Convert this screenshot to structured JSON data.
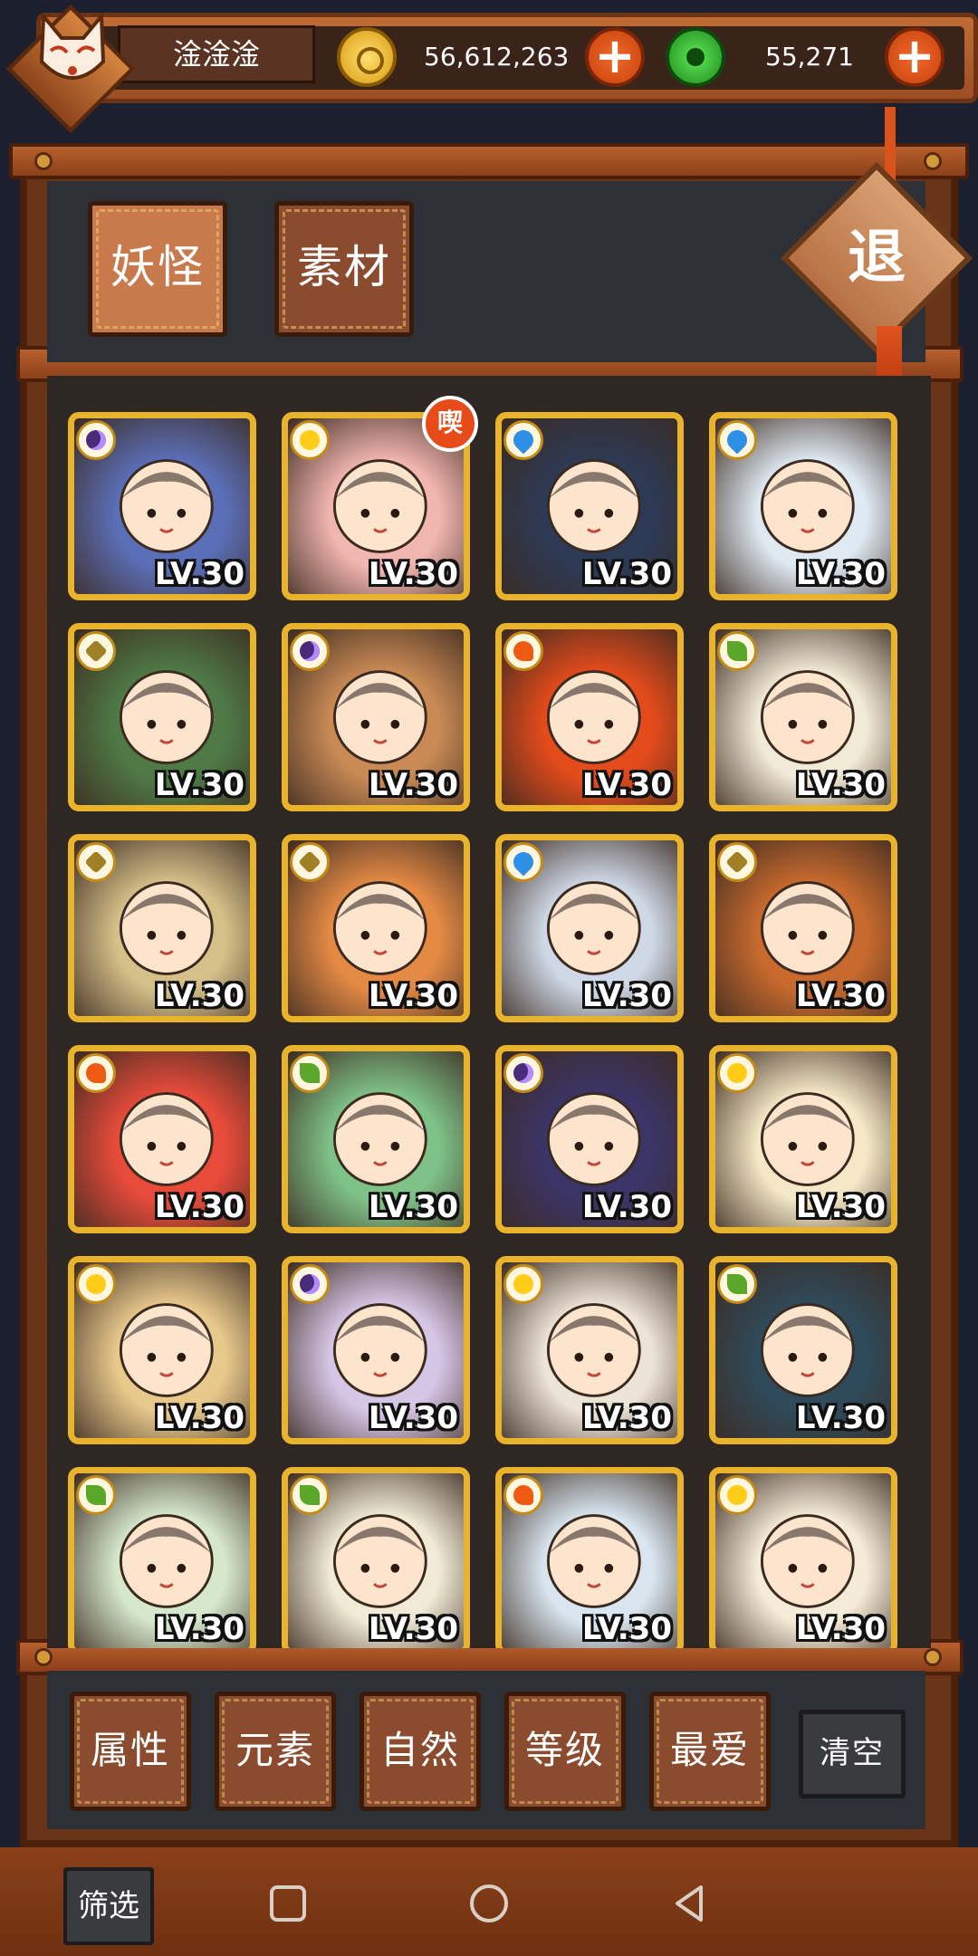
{
  "player": {
    "name": "淦淦淦"
  },
  "currency": {
    "gold": {
      "icon": "gold-coin-icon",
      "value": "56,612,263"
    },
    "jade": {
      "icon": "jade-coin-icon",
      "value": "55,271"
    }
  },
  "tabs": [
    {
      "label": "妖怪",
      "active": true
    },
    {
      "label": "素材",
      "active": false
    }
  ],
  "exit_label": "退",
  "favorite_badge": "喫",
  "level_text": "LV.30",
  "element_colors": {
    "dark": "#4a2a7a",
    "light": "#ffcc18",
    "water": "#2d8fe6",
    "earth": "#a08024",
    "fire": "#ef5a13",
    "nature": "#5aa72a"
  },
  "monsters": [
    {
      "element": "dark",
      "level": "LV.30",
      "favorite": false,
      "bg": "#5b6fb8"
    },
    {
      "element": "light",
      "level": "LV.30",
      "favorite": true,
      "bg": "#f2b6b0"
    },
    {
      "element": "water",
      "level": "LV.30",
      "favorite": false,
      "bg": "#2d3a55"
    },
    {
      "element": "water",
      "level": "LV.30",
      "favorite": false,
      "bg": "#dfe9f2"
    },
    {
      "element": "earth",
      "level": "LV.30",
      "favorite": false,
      "bg": "#4f7a46"
    },
    {
      "element": "dark",
      "level": "LV.30",
      "favorite": false,
      "bg": "#c98a55"
    },
    {
      "element": "fire",
      "level": "LV.30",
      "favorite": false,
      "bg": "#e34b1b"
    },
    {
      "element": "nature",
      "level": "LV.30",
      "favorite": false,
      "bg": "#f1ead6"
    },
    {
      "element": "earth",
      "level": "LV.30",
      "favorite": false,
      "bg": "#d6c08a"
    },
    {
      "element": "earth",
      "level": "LV.30",
      "favorite": false,
      "bg": "#e58a45"
    },
    {
      "element": "water",
      "level": "LV.30",
      "favorite": false,
      "bg": "#cfd8e6"
    },
    {
      "element": "earth",
      "level": "LV.30",
      "favorite": false,
      "bg": "#c86a2e"
    },
    {
      "element": "fire",
      "level": "LV.30",
      "favorite": false,
      "bg": "#e84b3a"
    },
    {
      "element": "nature",
      "level": "LV.30",
      "favorite": false,
      "bg": "#7fc288"
    },
    {
      "element": "dark",
      "level": "LV.30",
      "favorite": false,
      "bg": "#3b3567"
    },
    {
      "element": "light",
      "level": "LV.30",
      "favorite": false,
      "bg": "#f4e8c6"
    },
    {
      "element": "light",
      "level": "LV.30",
      "favorite": false,
      "bg": "#e8c98c"
    },
    {
      "element": "dark",
      "level": "LV.30",
      "favorite": false,
      "bg": "#d6c6e6"
    },
    {
      "element": "light",
      "level": "LV.30",
      "favorite": false,
      "bg": "#ece4d6"
    },
    {
      "element": "nature",
      "level": "LV.30",
      "favorite": false,
      "bg": "#2f4a5a"
    },
    {
      "element": "nature",
      "level": "LV.30",
      "favorite": false,
      "bg": "#d6e8cc"
    },
    {
      "element": "nature",
      "level": "LV.30",
      "favorite": false,
      "bg": "#f0ead6"
    },
    {
      "element": "fire",
      "level": "LV.30",
      "favorite": false,
      "bg": "#d9e6f0"
    },
    {
      "element": "light",
      "level": "LV.30",
      "favorite": false,
      "bg": "#f5ecd8"
    }
  ],
  "filters": [
    {
      "label": "属性"
    },
    {
      "label": "元素"
    },
    {
      "label": "自然"
    },
    {
      "label": "等级"
    },
    {
      "label": "最爱"
    }
  ],
  "clear_label": "清空",
  "filter_toggle_label": "筛选",
  "nav": [
    "recents-icon",
    "home-icon",
    "back-icon"
  ]
}
